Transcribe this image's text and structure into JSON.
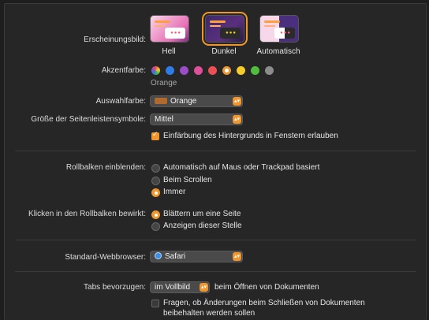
{
  "appearance": {
    "label": "Erscheinungsbild:",
    "options": [
      {
        "name": "Hell",
        "selected": false
      },
      {
        "name": "Dunkel",
        "selected": true
      },
      {
        "name": "Automatisch",
        "selected": false
      }
    ]
  },
  "accent": {
    "label": "Akzentfarbe:",
    "selected_name": "Orange",
    "colors": [
      "multicolor",
      "#2f7ce6",
      "#9b4dc7",
      "#e0509a",
      "#ec4f54",
      "#f0962e",
      "#f5cc28",
      "#4fbe3c",
      "#8c8c8c"
    ]
  },
  "highlight": {
    "label": "Auswahlfarbe:",
    "value": "Orange"
  },
  "sidebar_icons": {
    "label": "Größe der Seitenleistensymbole:",
    "value": "Mittel"
  },
  "wallpaper_tinting": {
    "label": "Einfärbung des Hintergrunds in Fenstern erlauben",
    "checked": true
  },
  "scrollbars": {
    "label": "Rollbalken einblenden:",
    "options": [
      {
        "label": "Automatisch auf Maus oder Trackpad basiert",
        "selected": false
      },
      {
        "label": "Beim Scrollen",
        "selected": false
      },
      {
        "label": "Immer",
        "selected": true
      }
    ]
  },
  "click_scrollbar": {
    "label": "Klicken in den Rollbalken bewirkt:",
    "options": [
      {
        "label": "Blättern um eine Seite",
        "selected": true
      },
      {
        "label": "Anzeigen dieser Stelle",
        "selected": false
      }
    ]
  },
  "browser": {
    "label": "Standard-Webbrowser:",
    "value": "Safari"
  },
  "tabs": {
    "label": "Tabs bevorzugen:",
    "value": "im Vollbild",
    "suffix": "beim Öffnen von Dokumenten"
  },
  "ask_keep_changes": {
    "line1": "Fragen, ob Änderungen beim Schließen von Dokumenten",
    "line2": "beibehalten werden sollen",
    "checked": false
  },
  "colors": {
    "accent": "#f0962e",
    "background": "#262626"
  }
}
